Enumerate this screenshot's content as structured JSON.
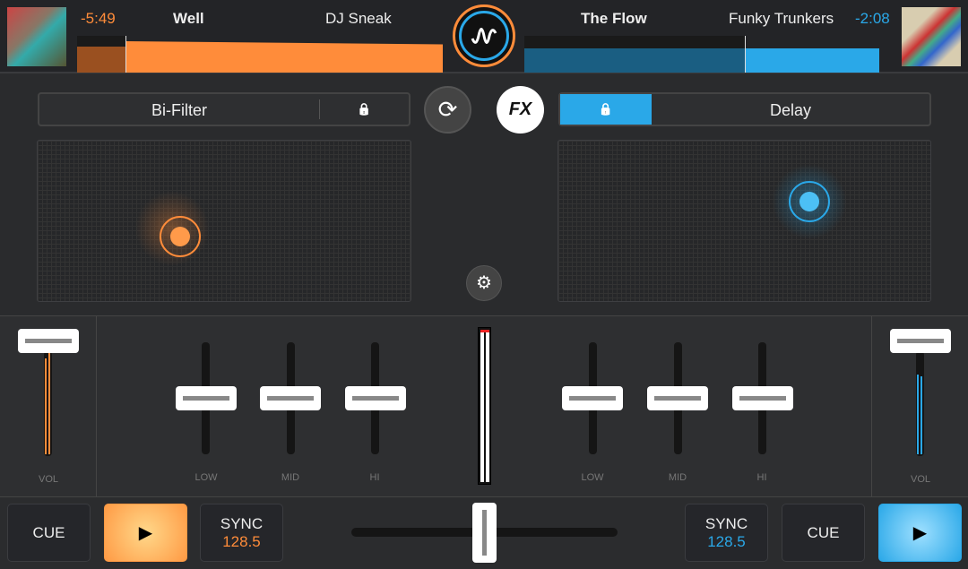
{
  "deck_a": {
    "time": "-5:49",
    "title": "Well",
    "artist": "DJ Sneak",
    "fx": "Bi-Filter",
    "lock": "🔒",
    "cue": "CUE",
    "sync": "SYNC",
    "bpm": "128.5",
    "vol": "VOL",
    "eq": [
      "LOW",
      "MID",
      "HI"
    ],
    "color": "#ff8c3a"
  },
  "deck_b": {
    "time": "-2:08",
    "title": "The Flow",
    "artist": "Funky Trunkers",
    "fx": "Delay",
    "lock": "🔒",
    "cue": "CUE",
    "sync": "SYNC",
    "bpm": "128.5",
    "vol": "VOL",
    "eq": [
      "LOW",
      "MID",
      "HI"
    ],
    "color": "#2aa8e8"
  },
  "center": {
    "fx_label": "FX",
    "play": "▶"
  }
}
